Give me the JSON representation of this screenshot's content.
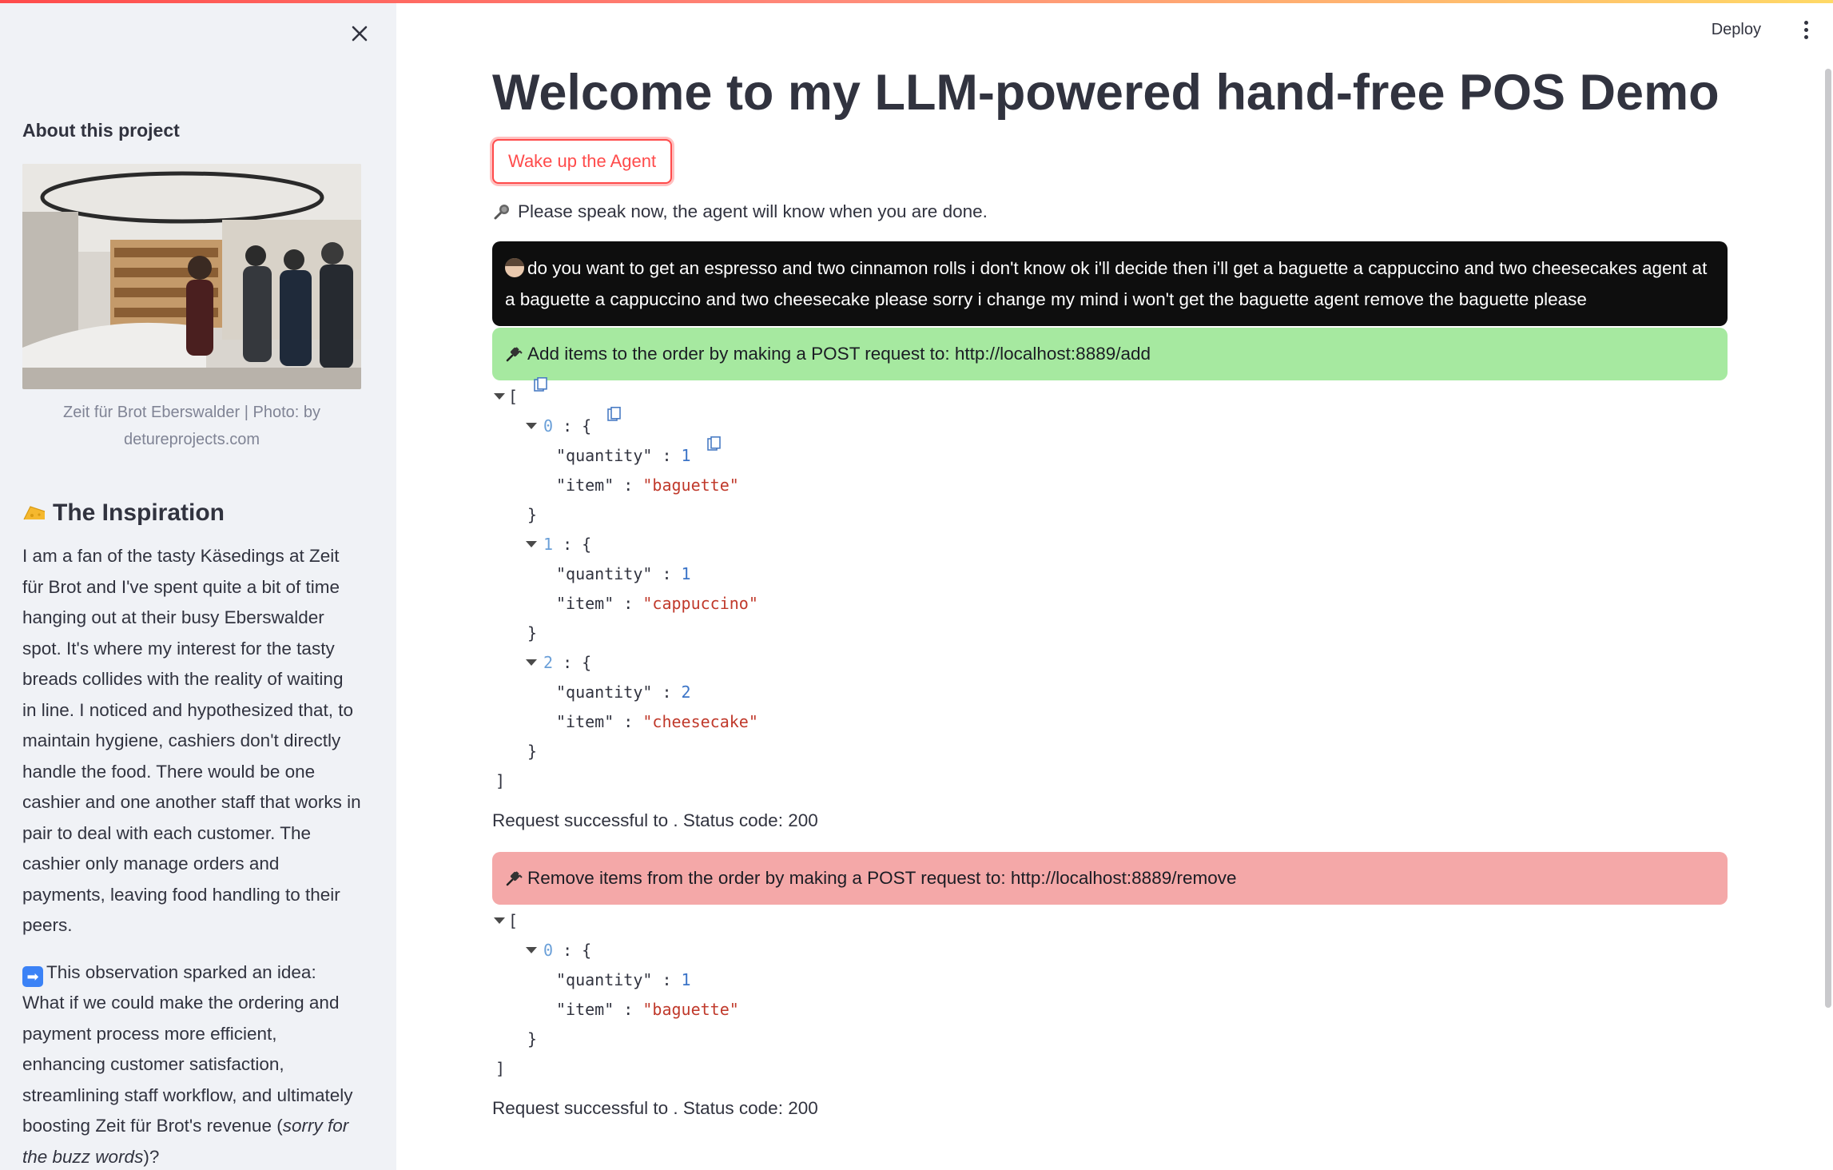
{
  "sidebar": {
    "about_heading": "About this project",
    "photo_caption": "Zeit für Brot Eberswalder | Photo: by detureprojects.com",
    "inspiration_heading": "The Inspiration",
    "inspiration_p1": "I am a fan of the tasty Käsedings at Zeit für Brot and I've spent quite a bit of time hanging out at their busy Eberswalder spot. It's where my interest for the tasty breads collides with the reality of waiting in line. I noticed and hypothesized that, to maintain hygiene, cashiers don't directly handle the food. There would be one cashier and one another staff that works in pair to deal with each customer. The cashier only manage orders and payments, leaving food handling to their peers.",
    "inspiration_p2": "This observation sparked an idea: What if we could make the ordering and payment process more efficient, enhancing customer satisfaction, streamlining staff workflow, and ultimately boosting Zeit für Brot's revenue (",
    "inspiration_p2_italic": "sorry for the buzz words",
    "inspiration_p2_end": ")?",
    "arrow_emoji": "➡"
  },
  "header": {
    "deploy_label": "Deploy"
  },
  "main": {
    "title": "Welcome to my LLM-powered hand-free POS Demo",
    "wake_button": "Wake up the Agent",
    "speak_prompt": "Please speak now, the agent will know when you are done.",
    "transcript": "do you want to get an espresso and two cinnamon rolls i don't know ok i'll decide then i'll get a baguette a cappuccino and two cheesecakes agent at a baguette a cappuccino and two cheesecake please sorry i change my mind i won't get the baguette agent remove the baguette please",
    "add_alert": "Add items to the order by making a POST request to: http://localhost:8889/add",
    "add_items": [
      {
        "index": "0",
        "quantity": "1",
        "item": "\"baguette\""
      },
      {
        "index": "1",
        "quantity": "1",
        "item": "\"cappuccino\""
      },
      {
        "index": "2",
        "quantity": "2",
        "item": "\"cheesecake\""
      }
    ],
    "add_status": "Request successful to . Status code: 200",
    "remove_alert": "Remove items from the order by making a POST request to: http://localhost:8889/remove",
    "remove_items": [
      {
        "index": "0",
        "quantity": "1",
        "item": "\"baguette\""
      }
    ],
    "remove_status": "Request successful to . Status code: 200",
    "json_key_quantity": "\"quantity\"",
    "json_key_item": "\"item\""
  },
  "colors": {
    "accent": "#ff4b4b",
    "sidebar_bg": "#f0f2f6",
    "success_bg": "#a6e9a0",
    "error_bg": "#f4a8a8"
  }
}
